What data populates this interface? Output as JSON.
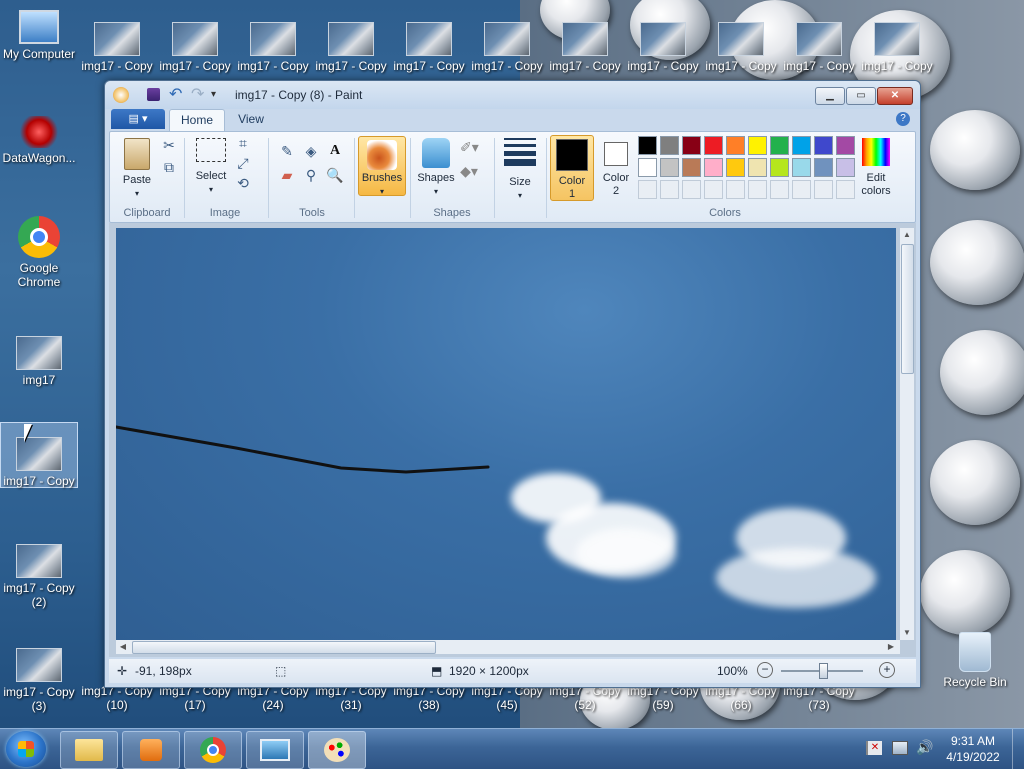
{
  "desktop": {
    "icons": [
      {
        "label": "My Computer"
      },
      {
        "label": "DataWagon..."
      },
      {
        "label": "Google Chrome"
      },
      {
        "label": "img17"
      },
      {
        "label": "img17 - Copy"
      },
      {
        "label": "img17 - Copy (2)"
      },
      {
        "label": "img17 - Copy (3)"
      },
      {
        "label": "Recycle Bin"
      }
    ],
    "top_row_labels": [
      "img17 - Copy",
      "img17 - Copy",
      "img17 - Copy",
      "img17 - Copy",
      "img17 - Copy",
      "img17 - Copy",
      "img17 - Copy",
      "img17 - Copy",
      "img17 - Copy",
      "img17 - Copy",
      "img17 - Copy"
    ],
    "bottom_row_labels": [
      "(10)",
      "(17)",
      "(24)",
      "(31)",
      "(38)",
      "(45)",
      "(52)",
      "(59)",
      "(66)",
      "(73)"
    ],
    "bottom_row_prefix": "img17 - Copy"
  },
  "paint": {
    "title": "img17 - Copy (8) - Paint",
    "tabs": {
      "home": "Home",
      "view": "View"
    },
    "groups": {
      "clipboard": "Clipboard",
      "image": "Image",
      "tools": "Tools",
      "shapes": "Shapes",
      "colors": "Colors"
    },
    "buttons": {
      "paste": "Paste",
      "select": "Select",
      "brushes": "Brushes",
      "shapes": "Shapes",
      "size": "Size",
      "color1": "Color 1",
      "color2": "Color 2",
      "edit_colors": "Edit colors"
    },
    "palette_row1": [
      "#000000",
      "#7f7f7f",
      "#880015",
      "#ed1c24",
      "#ff7f27",
      "#fff200",
      "#22b14c",
      "#00a2e8",
      "#3f48cc",
      "#a349a4"
    ],
    "palette_row2": [
      "#ffffff",
      "#c3c3c3",
      "#b97a57",
      "#ffaec9",
      "#ffc90e",
      "#efe4b0",
      "#b5e61d",
      "#99d9ea",
      "#7092be",
      "#c8bfe7"
    ],
    "color1": "#000000",
    "color2": "#ffffff",
    "status": {
      "cursor_pos": "-91, 198px",
      "image_size": "1920 × 1200px",
      "zoom": "100%"
    }
  },
  "taskbar": {
    "time": "9:31 AM",
    "date": "4/19/2022"
  }
}
